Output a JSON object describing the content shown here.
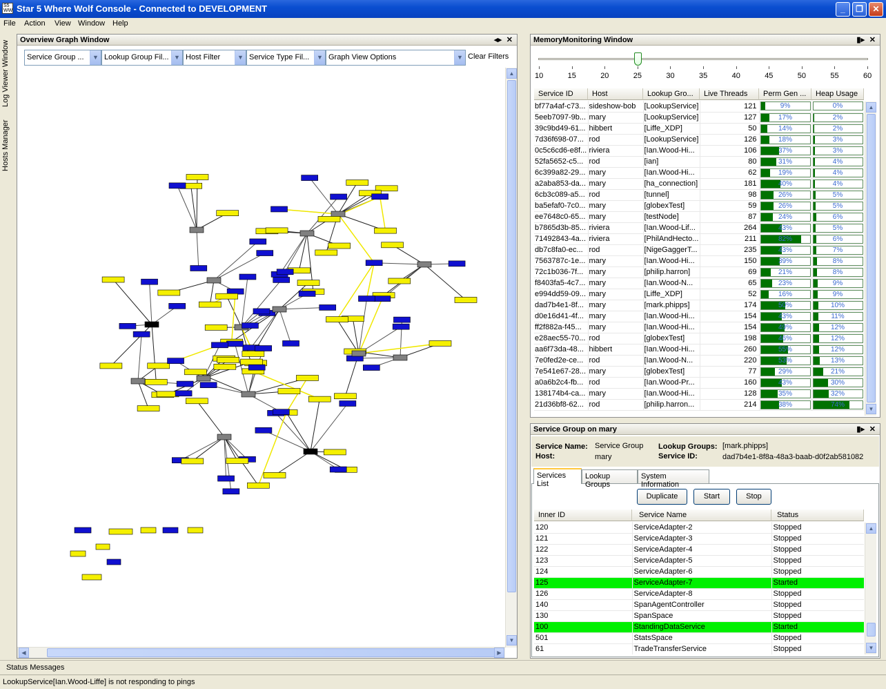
{
  "window": {
    "title": "Star 5 Where Wolf Console - Connected to DEVELOPMENT",
    "minimize": "_",
    "maximize": "❐",
    "close": "✕"
  },
  "menu": [
    "File",
    "Action",
    "View",
    "Window",
    "Help"
  ],
  "side_tabs": [
    "Log Viewer Window",
    "Hosts Manager"
  ],
  "graph_panel": {
    "title": "Overview Graph Window",
    "filters": [
      "Service Group ...",
      "Lookup Group Fil...",
      "Host Filter",
      "Service Type Fil...",
      "Graph View Options"
    ],
    "clear_filters": "Clear Filters"
  },
  "memory_panel": {
    "title": "MemoryMonitoring Window",
    "slider": {
      "ticks": [
        "10",
        "15",
        "20",
        "25",
        "30",
        "35",
        "40",
        "45",
        "50",
        "55",
        "60"
      ],
      "value": 25,
      "min": 10,
      "max": 60
    },
    "columns": [
      "Service ID",
      "Host",
      "Lookup Gro...",
      "Live Threads",
      "Perm Gen ...",
      "Heap Usage"
    ],
    "rows": [
      {
        "id": "bf77a4af-c73...",
        "host": "sideshow-bob",
        "group": "[LookupService]",
        "threads": "121",
        "perm": "9%",
        "perm_v": 0.09,
        "heap": "0%",
        "heap_v": 0.0
      },
      {
        "id": "5eeb7097-9b...",
        "host": "mary",
        "group": "[LookupService]",
        "threads": "127",
        "perm": "17%",
        "perm_v": 0.17,
        "heap": "2%",
        "heap_v": 0.02
      },
      {
        "id": "39c9bd49-61...",
        "host": "hibbert",
        "group": "[Liffe_XDP]",
        "threads": "50",
        "perm": "14%",
        "perm_v": 0.14,
        "heap": "2%",
        "heap_v": 0.02
      },
      {
        "id": "7d36f698-07...",
        "host": "rod",
        "group": "[LookupService]",
        "threads": "126",
        "perm": "18%",
        "perm_v": 0.18,
        "heap": "3%",
        "heap_v": 0.03
      },
      {
        "id": "0c5c6cd6-e8f...",
        "host": "riviera",
        "group": "[Ian.Wood-Hi...",
        "threads": "106",
        "perm": "37%",
        "perm_v": 0.37,
        "heap": "3%",
        "heap_v": 0.03
      },
      {
        "id": "52fa5652-c5...",
        "host": "rod",
        "group": "[ian]",
        "threads": "80",
        "perm": "31%",
        "perm_v": 0.31,
        "heap": "4%",
        "heap_v": 0.04
      },
      {
        "id": "6c399a82-29...",
        "host": "mary",
        "group": "[Ian.Wood-Hi...",
        "threads": "62",
        "perm": "19%",
        "perm_v": 0.19,
        "heap": "4%",
        "heap_v": 0.04
      },
      {
        "id": "a2aba853-da...",
        "host": "mary",
        "group": "[ha_connection]",
        "threads": "181",
        "perm": "40%",
        "perm_v": 0.4,
        "heap": "4%",
        "heap_v": 0.04
      },
      {
        "id": "6cb3c089-a5...",
        "host": "rod",
        "group": "[tunnel]",
        "threads": "98",
        "perm": "26%",
        "perm_v": 0.26,
        "heap": "5%",
        "heap_v": 0.05
      },
      {
        "id": "ba5efaf0-7c0...",
        "host": "mary",
        "group": "[globexTest]",
        "threads": "59",
        "perm": "26%",
        "perm_v": 0.26,
        "heap": "5%",
        "heap_v": 0.05
      },
      {
        "id": "ee7648c0-65...",
        "host": "mary",
        "group": "[testNode]",
        "threads": "87",
        "perm": "24%",
        "perm_v": 0.24,
        "heap": "6%",
        "heap_v": 0.06
      },
      {
        "id": "b7865d3b-85...",
        "host": "riviera",
        "group": "[Ian.Wood-Lif...",
        "threads": "264",
        "perm": "43%",
        "perm_v": 0.43,
        "heap": "5%",
        "heap_v": 0.05
      },
      {
        "id": "71492843-4a...",
        "host": "riviera",
        "group": "[PhilAndHecto...",
        "threads": "211",
        "perm": "82%",
        "perm_v": 0.82,
        "heap": "6%",
        "heap_v": 0.06
      },
      {
        "id": "db7c8fa0-ec...",
        "host": "rod",
        "group": "[NigeGaggerT...",
        "threads": "235",
        "perm": "43%",
        "perm_v": 0.43,
        "heap": "7%",
        "heap_v": 0.07
      },
      {
        "id": "7563787c-1e...",
        "host": "mary",
        "group": "[Ian.Wood-Hi...",
        "threads": "150",
        "perm": "39%",
        "perm_v": 0.39,
        "heap": "8%",
        "heap_v": 0.08
      },
      {
        "id": "72c1b036-7f...",
        "host": "mary",
        "group": "[philip.harron]",
        "threads": "69",
        "perm": "21%",
        "perm_v": 0.21,
        "heap": "8%",
        "heap_v": 0.08
      },
      {
        "id": "f8403fa5-4c7...",
        "host": "mary",
        "group": "[Ian.Wood-N...",
        "threads": "65",
        "perm": "23%",
        "perm_v": 0.23,
        "heap": "9%",
        "heap_v": 0.09
      },
      {
        "id": "e994dd59-09...",
        "host": "mary",
        "group": "[Liffe_XDP]",
        "threads": "52",
        "perm": "16%",
        "perm_v": 0.16,
        "heap": "9%",
        "heap_v": 0.09
      },
      {
        "id": "dad7b4e1-8f...",
        "host": "mary",
        "group": "[mark.phipps]",
        "threads": "174",
        "perm": "50%",
        "perm_v": 0.5,
        "heap": "10%",
        "heap_v": 0.1
      },
      {
        "id": "d0e16d41-4f...",
        "host": "mary",
        "group": "[Ian.Wood-Hi...",
        "threads": "154",
        "perm": "43%",
        "perm_v": 0.43,
        "heap": "11%",
        "heap_v": 0.11
      },
      {
        "id": "ff2f882a-f45...",
        "host": "mary",
        "group": "[Ian.Wood-Hi...",
        "threads": "154",
        "perm": "49%",
        "perm_v": 0.49,
        "heap": "12%",
        "heap_v": 0.12
      },
      {
        "id": "e28aec55-70...",
        "host": "rod",
        "group": "[globexTest]",
        "threads": "198",
        "perm": "46%",
        "perm_v": 0.46,
        "heap": "12%",
        "heap_v": 0.12
      },
      {
        "id": "aa6f73da-48...",
        "host": "hibbert",
        "group": "[Ian.Wood-Hi...",
        "threads": "260",
        "perm": "55%",
        "perm_v": 0.55,
        "heap": "12%",
        "heap_v": 0.12
      },
      {
        "id": "7e0fed2e-ce...",
        "host": "rod",
        "group": "[Ian.Wood-N...",
        "threads": "220",
        "perm": "53%",
        "perm_v": 0.53,
        "heap": "13%",
        "heap_v": 0.13
      },
      {
        "id": "7e541e67-28...",
        "host": "mary",
        "group": "[globexTest]",
        "threads": "77",
        "perm": "29%",
        "perm_v": 0.29,
        "heap": "21%",
        "heap_v": 0.21
      },
      {
        "id": "a0a6b2c4-fb...",
        "host": "rod",
        "group": "[Ian.Wood-Pr...",
        "threads": "160",
        "perm": "43%",
        "perm_v": 0.43,
        "heap": "30%",
        "heap_v": 0.3
      },
      {
        "id": "138174b4-ca...",
        "host": "mary",
        "group": "[Ian.Wood-Hi...",
        "threads": "128",
        "perm": "35%",
        "perm_v": 0.35,
        "heap": "32%",
        "heap_v": 0.32
      },
      {
        "id": "21d36bf8-62...",
        "host": "rod",
        "group": "[philip.harron...",
        "threads": "214",
        "perm": "38%",
        "perm_v": 0.38,
        "heap": "74%",
        "heap_v": 0.74
      }
    ]
  },
  "group_panel": {
    "title": "Service Group on mary",
    "service_name_label": "Service Name:",
    "service_name": "Service Group",
    "host_label": "Host:",
    "host": "mary",
    "lookup_groups_label": "Lookup Groups:",
    "lookup_groups": "[mark.phipps]",
    "service_id_label": "Service ID:",
    "service_id": "dad7b4e1-8f8a-48a3-baab-d0f2ab581082",
    "tabs": [
      "Services List",
      "Lookup Groups",
      "System Information"
    ],
    "buttons": [
      "Duplicate",
      "Start",
      "Stop"
    ],
    "columns": [
      "Inner ID",
      "Service Name",
      "Status"
    ],
    "rows": [
      {
        "id": "120",
        "name": "ServiceAdapter-2",
        "status": "Stopped"
      },
      {
        "id": "121",
        "name": "ServiceAdapter-3",
        "status": "Stopped"
      },
      {
        "id": "122",
        "name": "ServiceAdapter-4",
        "status": "Stopped"
      },
      {
        "id": "123",
        "name": "ServiceAdapter-5",
        "status": "Stopped"
      },
      {
        "id": "124",
        "name": "ServiceAdapter-6",
        "status": "Stopped"
      },
      {
        "id": "125",
        "name": "ServiceAdapter-7",
        "status": "Started"
      },
      {
        "id": "126",
        "name": "ServiceAdapter-8",
        "status": "Stopped"
      },
      {
        "id": "140",
        "name": "SpanAgentController",
        "status": "Stopped"
      },
      {
        "id": "130",
        "name": "SpanSpace",
        "status": "Stopped"
      },
      {
        "id": "100",
        "name": "StandingDataService",
        "status": "Started"
      },
      {
        "id": "501",
        "name": "StatsSpace",
        "status": "Stopped"
      },
      {
        "id": "61",
        "name": "TradeTransferService",
        "status": "Stopped"
      }
    ]
  },
  "status": {
    "label": "Status Messages",
    "message": "LookupService[Ian.Wood-Liffe] is not responding to pings"
  },
  "colors": {
    "node_yellow": "#f5f000",
    "node_blue": "#1010d0",
    "node_gray": "#808080",
    "node_black": "#000000",
    "started_row": "#00f000",
    "perm_fill": "#007200"
  }
}
